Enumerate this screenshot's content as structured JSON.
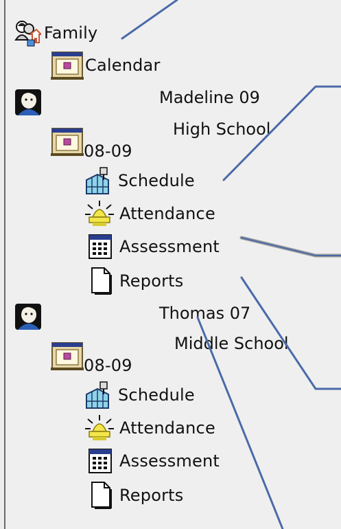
{
  "tree": {
    "family": {
      "label": "Family",
      "icon": "family-icon"
    },
    "family_calendar": {
      "label": "Calendar",
      "icon": "calendar-icon"
    },
    "students": [
      {
        "name": "Madeline 09",
        "school": "High School",
        "icon": "student-icon",
        "term": {
          "label": "08-09",
          "icon": "calendar-icon"
        },
        "items": [
          {
            "label": "Schedule",
            "icon": "schedule-icon"
          },
          {
            "label": "Attendance",
            "icon": "attendance-icon"
          },
          {
            "label": "Assessment",
            "icon": "assessment-icon"
          },
          {
            "label": "Reports",
            "icon": "reports-icon"
          }
        ]
      },
      {
        "name": "Thomas 07",
        "school": "Middle School",
        "icon": "student-icon",
        "term": {
          "label": "08-09",
          "icon": "calendar-icon"
        },
        "items": [
          {
            "label": "Schedule",
            "icon": "schedule-icon"
          },
          {
            "label": "Attendance",
            "icon": "attendance-icon"
          },
          {
            "label": "Assessment",
            "icon": "assessment-icon"
          },
          {
            "label": "Reports",
            "icon": "reports-icon"
          }
        ]
      }
    ]
  },
  "colors": {
    "background": "#efefef",
    "callout_line": "#4a6aa8",
    "callout_line_gray": "#9a9a9a"
  }
}
